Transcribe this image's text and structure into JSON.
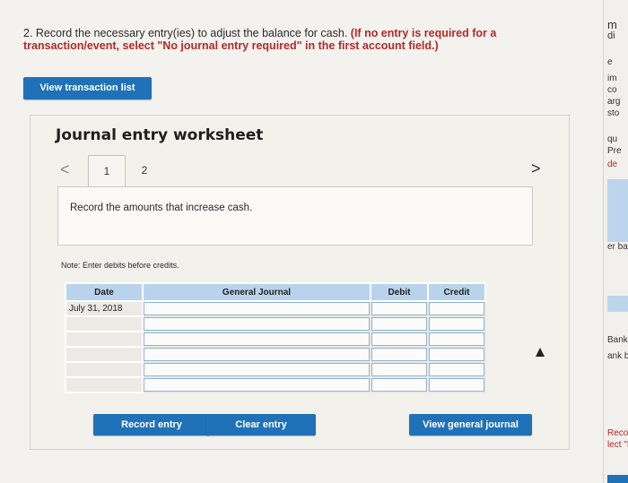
{
  "question": {
    "lead": "2. Record the necessary entry(ies) to adjust the balance for cash.",
    "hint": "(If no entry is required for a transaction/event, select \"No journal entry required\" in the first account field.)"
  },
  "buttons": {
    "view_transaction_list": "View transaction list",
    "record_entry": "Record entry",
    "clear_entry": "Clear entry",
    "view_general_journal": "View general journal"
  },
  "worksheet": {
    "title": "Journal entry worksheet",
    "prev": "<",
    "next": ">",
    "tabs": [
      "1",
      "2"
    ],
    "instruction": "Record the amounts that increase cash.",
    "note": "Note: Enter debits before credits."
  },
  "table": {
    "headers": [
      "Date",
      "General Journal",
      "Debit",
      "Credit"
    ],
    "rows": [
      {
        "date": "July 31, 2018",
        "account": "",
        "debit": "",
        "credit": ""
      },
      {
        "date": "",
        "account": "",
        "debit": "",
        "credit": ""
      },
      {
        "date": "",
        "account": "",
        "debit": "",
        "credit": ""
      },
      {
        "date": "",
        "account": "",
        "debit": "",
        "credit": ""
      },
      {
        "date": "",
        "account": "",
        "debit": "",
        "credit": ""
      },
      {
        "date": "",
        "account": "",
        "debit": "",
        "credit": ""
      }
    ]
  },
  "sidebar": {
    "fragments": [
      "m",
      "di",
      "e",
      "im",
      "co",
      "arg",
      "sto",
      "qu",
      "Pre",
      "de",
      "er ba",
      "Bank",
      "ank ba",
      "Record",
      "lect \"N"
    ]
  },
  "colors": {
    "button": "#1f72b8",
    "header": "#b9d3ec",
    "hint": "#b22a2a"
  }
}
